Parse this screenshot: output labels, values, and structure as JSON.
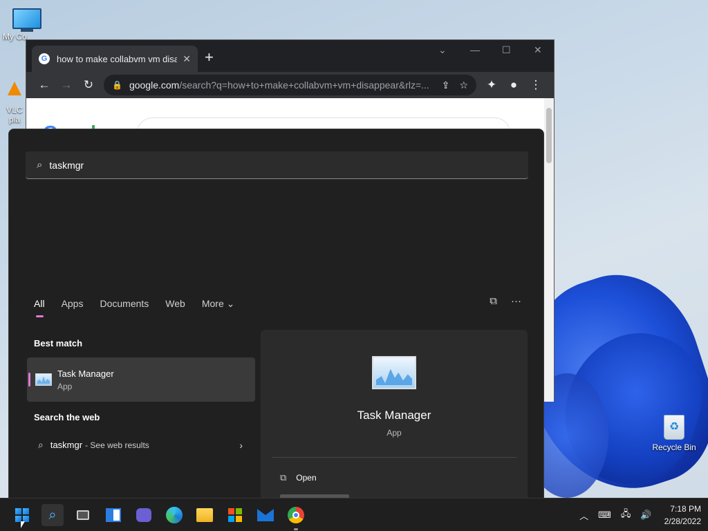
{
  "desktop": {
    "icons": {
      "my_computer": "My Co",
      "vlc_line1": "VLC",
      "vlc_line2": "pla",
      "recycle_bin": "Recycle Bin"
    }
  },
  "chrome": {
    "tab_title": "how to make collabvm vm disapp",
    "tab_favicon": "G",
    "new_tab": "+",
    "url_domain": "google.com",
    "url_path": "/search?q=how+to+make+collabvm+vm+disappear&rlz=...",
    "google_logo": "Google",
    "google_query": "how to make collabvm vm disappear"
  },
  "search": {
    "query": "taskmgr",
    "tabs": [
      "All",
      "Apps",
      "Documents",
      "Web",
      "More"
    ],
    "best_match_title": "Best match",
    "best_match": {
      "name": "Task Manager",
      "type": "App"
    },
    "web_title": "Search the web",
    "web_query": "taskmgr",
    "web_suffix": "- See web results",
    "preview": {
      "name": "Task Manager",
      "type": "App",
      "open_label": "Open"
    }
  },
  "taskbar": {
    "time": "7:18 PM",
    "date": "2/28/2022"
  },
  "colors": {
    "accent_pink": "#e07ad0",
    "taskbar": "#1f1f1f",
    "panel": "#202020"
  },
  "icons": [
    "search-icon",
    "windows-start-icon",
    "task-view-icon",
    "widgets-icon",
    "chat-icon",
    "edge-icon",
    "file-explorer-icon",
    "store-icon",
    "mail-icon",
    "chrome-icon"
  ]
}
